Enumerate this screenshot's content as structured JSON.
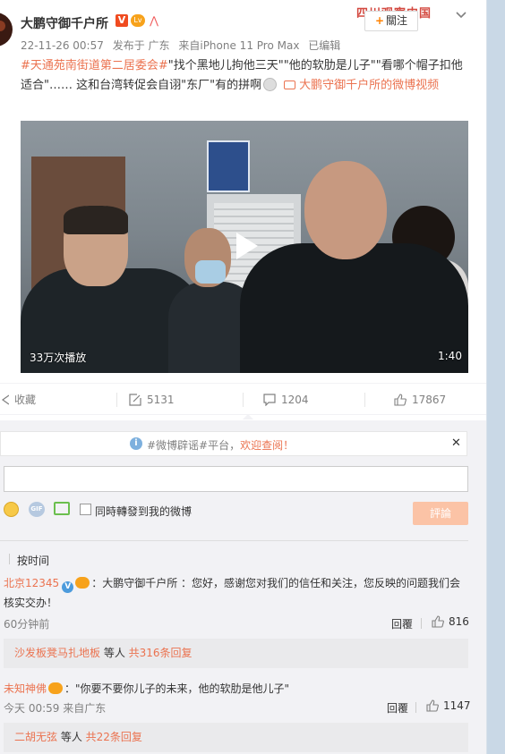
{
  "post": {
    "username": "大鹏守御千户所",
    "watermark": "四川观察中国",
    "follow_label": "關注",
    "timestamp": "22-11-26 00:57",
    "published_in": "发布于 广东",
    "source": "来自iPhone 11 Pro Max",
    "edited": "已编辑",
    "hashtag": "#天通苑南街道第二居委会#",
    "body_text": "\"找个黑地儿拘他三天\"\"他的软肋是儿子\"\"看哪个帽子扣他适合\"…… 这和台湾转促会自诩\"东厂\"有的拼啊",
    "video_link": "大鹏守御千户所的微博视频"
  },
  "video": {
    "view_count": "33万次播放",
    "duration": "1:40"
  },
  "actions": {
    "favorite": "收藏",
    "repost": "5131",
    "comments": "1204",
    "likes": "17867"
  },
  "notice": {
    "prefix": "#微博辟谣#平台，",
    "highlight": "欢迎查阅！"
  },
  "composer": {
    "repost_label": "同時轉發到我的微博",
    "submit_label": "評論"
  },
  "sort": {
    "label": "按时间"
  },
  "comments": [
    {
      "user": "北京12345",
      "text": "：大鹏守御千户所 ：您好，感谢您对我们的信任和关注，您反映的问题我们会核实交办！",
      "time": "60分钟前",
      "reply_label": "回覆",
      "likes": "816",
      "sub_reply_users": "沙发板凳马扎地板",
      "sub_reply_mid": " 等人 ",
      "sub_reply_count": "共316条回复"
    },
    {
      "user": "未知神佛",
      "text": "：\"你要不要你儿子的未来，他的软肋是他儿子\"",
      "time": "今天 00:59 来自广东",
      "reply_label": "回覆",
      "likes": "1147",
      "sub_reply_users": "二胡无弦",
      "sub_reply_mid": " 等人 ",
      "sub_reply_count": "共22条回复"
    }
  ],
  "colors": {
    "accent": "#eb7350",
    "submit_disabled": "#fbc3a6",
    "panel_bg": "#f2f2f5"
  }
}
